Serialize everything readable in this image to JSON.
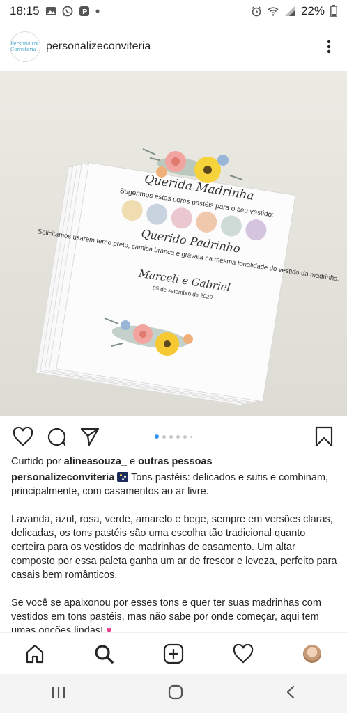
{
  "status_bar": {
    "time": "18:15",
    "battery": "22%",
    "left_icons": [
      "image-icon",
      "whatsapp-icon",
      "p-app-icon",
      "dot-icon"
    ],
    "right_icons": [
      "alarm-icon",
      "wifi-icon",
      "signal-icon",
      "battery-icon"
    ]
  },
  "header": {
    "username": "personalizeconviteria",
    "avatar_text": "Personalize Conviteria"
  },
  "post": {
    "image_desc_icons": [
      "flower-wreath"
    ],
    "card": {
      "title1": "Querida Madrinha",
      "line1": "Sugerimos estas cores pastéis para o seu vestido:",
      "title2": "Querido Padrinho",
      "line2": "Solicitamos usarem terno preto, camisa branca e gravata na mesma tonalidade do vestido da madrinha.",
      "names": "Marceli e Gabriel",
      "date": "05 de setembro de 2020",
      "swatches": [
        "#efdcb0",
        "#c9d3df",
        "#ebc8cf",
        "#f0c9ad",
        "#cfdbd7",
        "#d5c4de"
      ]
    },
    "carousel": {
      "count": 6,
      "active": 0
    }
  },
  "likes": {
    "prefix": "Curtido por",
    "user": "alineasouza_",
    "middle": "e",
    "others": "outras pessoas"
  },
  "caption": {
    "user": "personalizeconviteria",
    "p1": "Tons pastéis: delicados e sutis e combinam, principalmente, com casamentos ao ar livre.",
    "p2": "Lavanda, azul, rosa, verde, amarelo e bege, sempre em versões claras, delicadas, os tons pastéis são uma escolha tão tradicional quanto certeira para os vestidos de madrinhas de casamento. Um altar composto por essa paleta ganha um ar de frescor e leveza, perfeito para casais bem românticos.",
    "p3": "Se você se apaixonou por esses tons e quer ter suas madrinhas com vestidos em tons pastéis, mas não sabe por onde começar, aqui tem umas opções lindas!"
  },
  "colors": {
    "accent": "#3897f0",
    "text": "#262626",
    "divider": "#efefef"
  }
}
